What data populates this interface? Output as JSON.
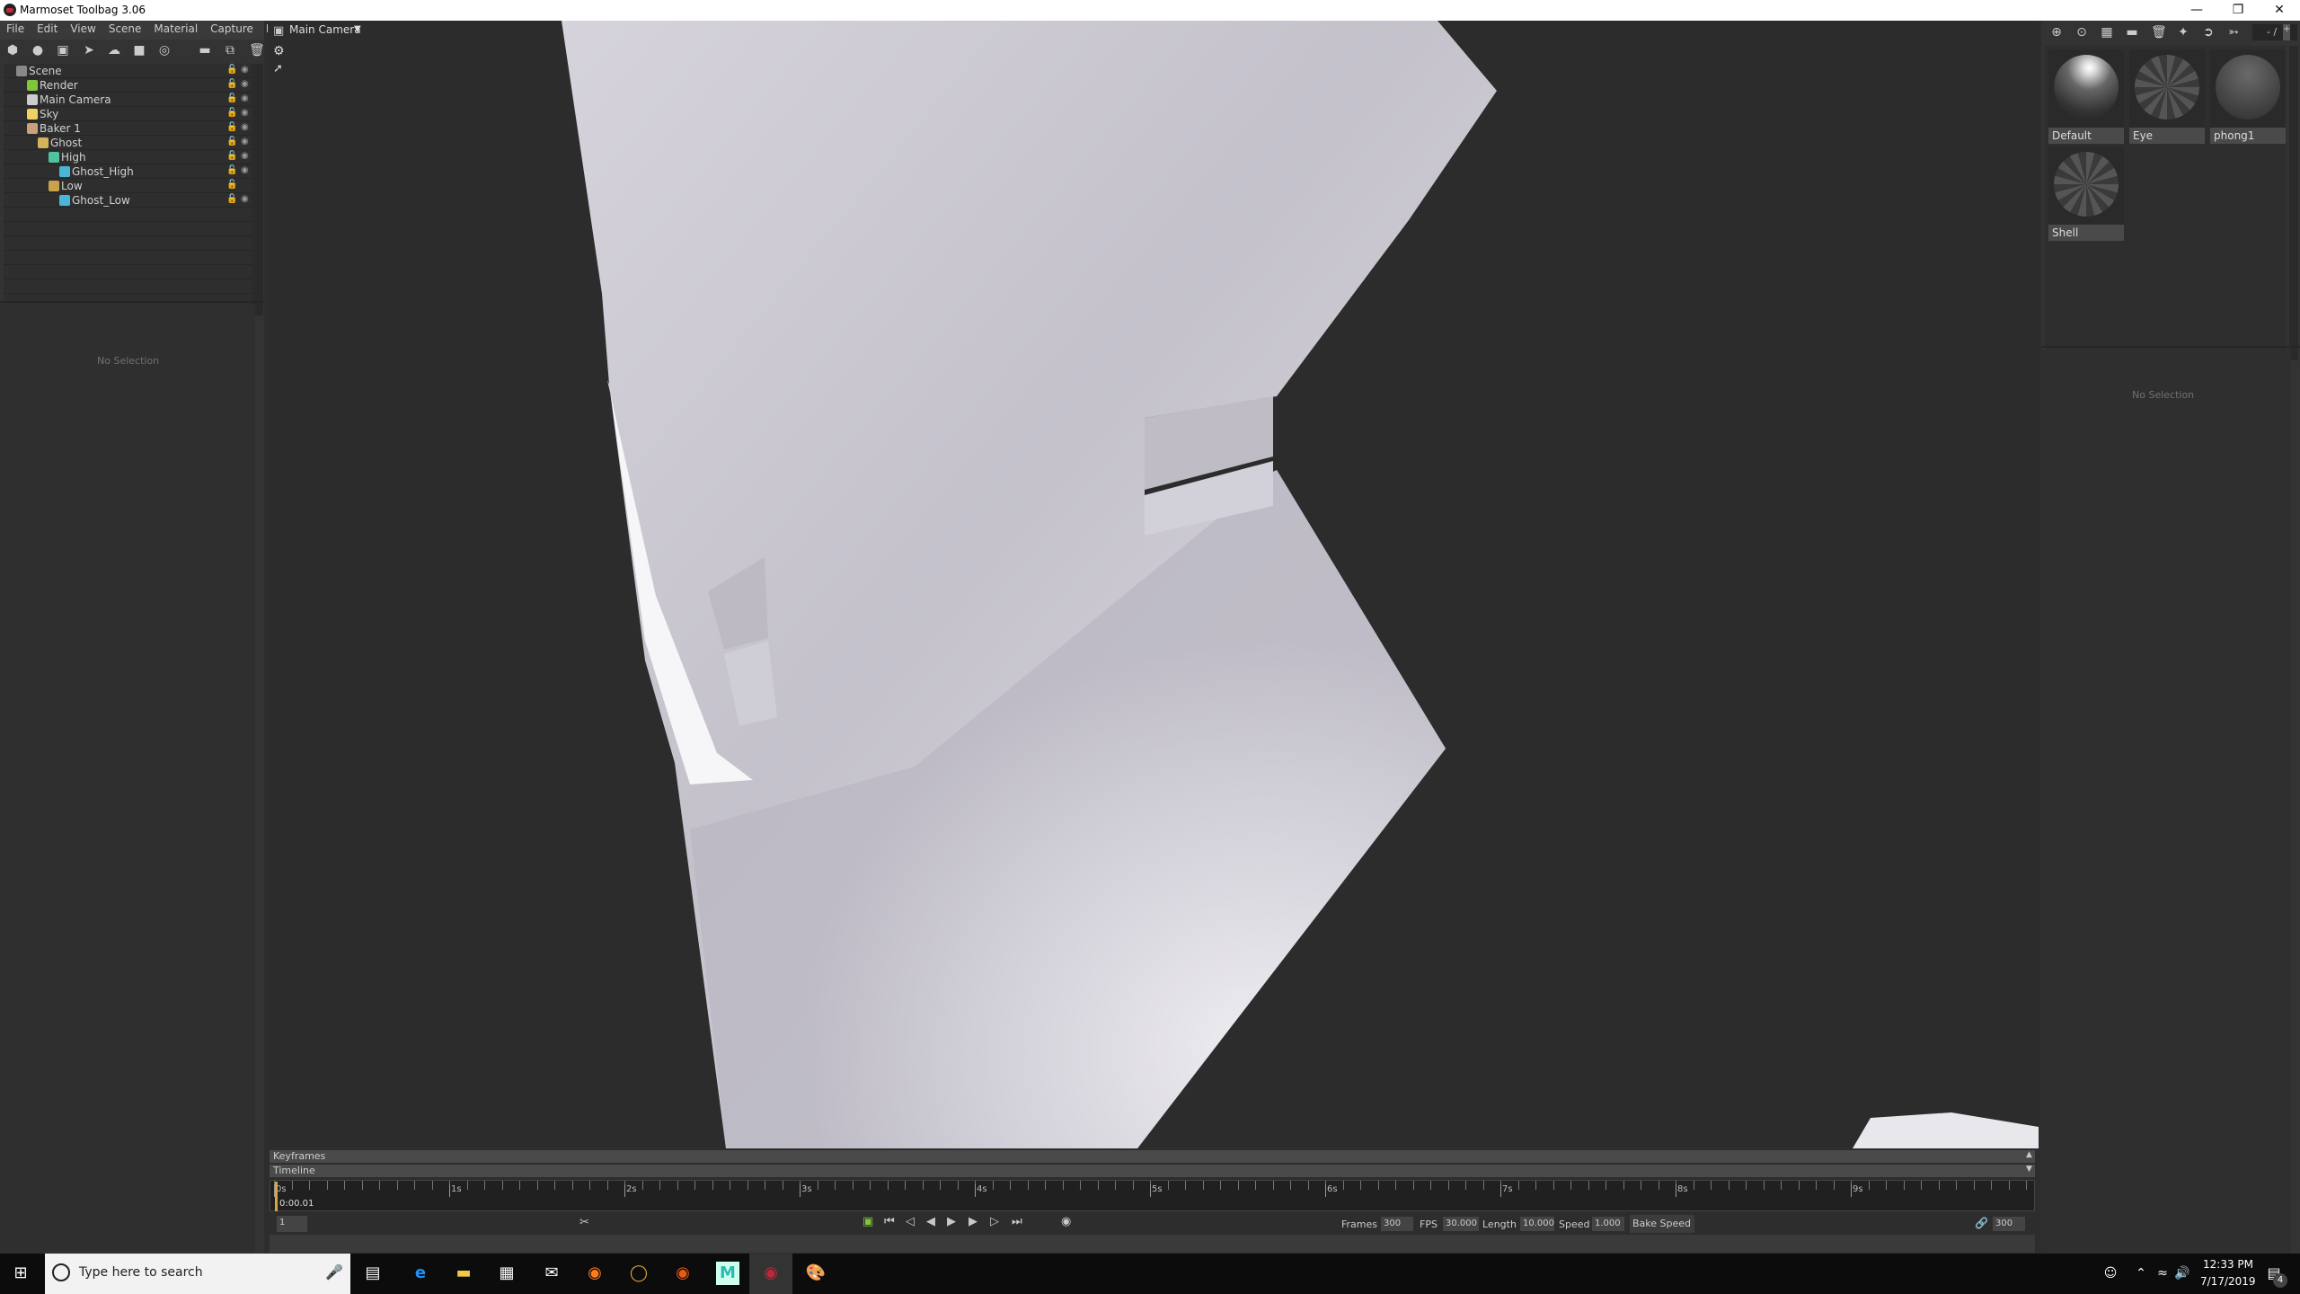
{
  "window": {
    "title": "Marmoset Toolbag 3.06",
    "controls": [
      "minimize",
      "restore",
      "close"
    ]
  },
  "menu": [
    "File",
    "Edit",
    "View",
    "Scene",
    "Material",
    "Capture",
    "Help"
  ],
  "toolbar_icons": [
    "mesh-icon",
    "light-icon",
    "camera-icon",
    "shadow-catcher-icon",
    "sky-icon",
    "baker-icon",
    "turntable-icon",
    "folder-icon",
    "duplicate-icon",
    "trash-icon"
  ],
  "scene_tree": [
    {
      "label": "Scene",
      "icon": "scene-icon",
      "depth": 0,
      "eye": true
    },
    {
      "label": "Render",
      "icon": "render-gear-icon",
      "depth": 1,
      "eye": true
    },
    {
      "label": "Main Camera",
      "icon": "camera-icon",
      "depth": 1,
      "eye": true
    },
    {
      "label": "Sky",
      "icon": "sky-icon",
      "depth": 1,
      "eye": true
    },
    {
      "label": "Baker 1",
      "icon": "baker-icon",
      "depth": 1,
      "eye": true
    },
    {
      "label": "Ghost",
      "icon": "folder-icon",
      "depth": 2,
      "eye": true
    },
    {
      "label": "High",
      "icon": "high-group-icon",
      "depth": 3,
      "eye": true
    },
    {
      "label": "Ghost_High",
      "icon": "mesh-icon",
      "depth": 4,
      "eye": true
    },
    {
      "label": "Low",
      "icon": "low-group-icon",
      "depth": 3,
      "eye": false
    },
    {
      "label": "Ghost_Low",
      "icon": "mesh-icon",
      "depth": 4,
      "eye": true
    }
  ],
  "left_properties": {
    "empty": "No Selection"
  },
  "viewport": {
    "camera": "Main Camera"
  },
  "materials": {
    "toolbar_icons": [
      "add-material-icon",
      "duplicate-material-icon",
      "checker-icon",
      "folder-icon",
      "trash-icon",
      "pick-material-icon",
      "export-icon",
      "import-icon"
    ],
    "page": "- /",
    "page_plus": "+",
    "items": [
      "Default",
      "Eye",
      "phong1",
      "Shell"
    ]
  },
  "right_properties": {
    "empty": "No Selection"
  },
  "timeline": {
    "keyframes_label": "Keyframes",
    "timeline_label": "Timeline",
    "seconds": [
      "0s",
      "1s",
      "2s",
      "3s",
      "4s",
      "5s",
      "6s",
      "7s",
      "8s",
      "9s"
    ],
    "current_time": "0:00.01",
    "frame": "1",
    "frames_label": "Frames",
    "frames": "300",
    "fps_label": "FPS",
    "fps": "30.000",
    "length_label": "Length",
    "length": "10.000",
    "speed_label": "Speed",
    "speed": "1.000",
    "bake_speed": "Bake Speed",
    "end_frame": "300"
  },
  "taskbar": {
    "search_placeholder": "Type here to search",
    "time": "12:33 PM",
    "date": "7/17/2019",
    "notifications": "4"
  },
  "colors": {
    "accent_green": "#7fc63a",
    "playhead": "#d9a441"
  }
}
